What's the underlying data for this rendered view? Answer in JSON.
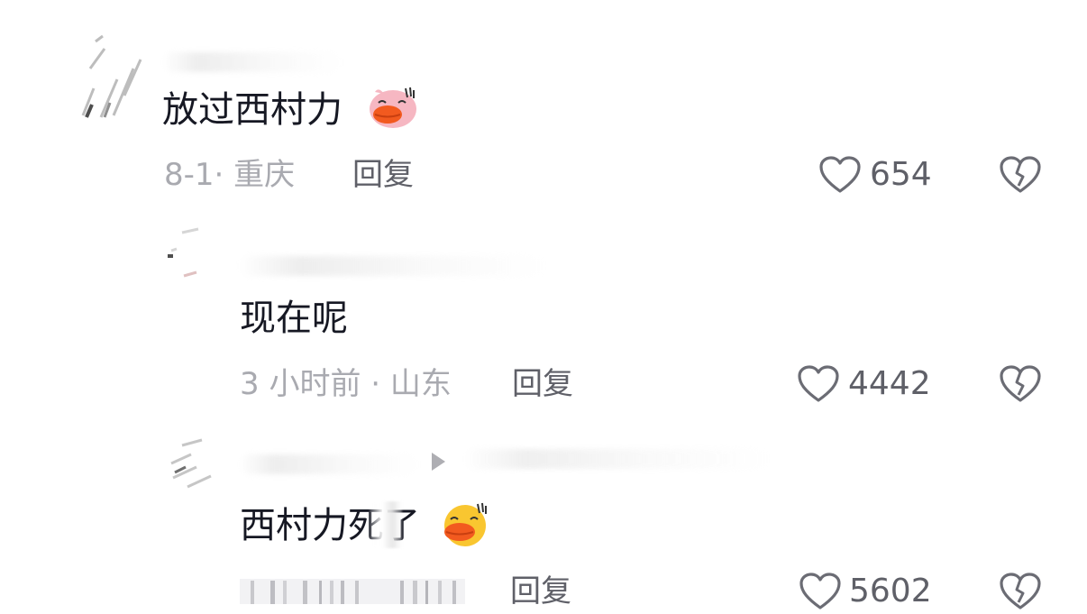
{
  "comments": [
    {
      "text": "放过西村力",
      "emoji": "pig-face-emoji",
      "meta": "8-1· 重庆",
      "reply_label": "回复",
      "likes": "654"
    },
    {
      "text": "现在呢",
      "meta": "3 小时前 · 山东",
      "reply_label": "回复",
      "likes": "4442"
    },
    {
      "text": "西村力死了",
      "text_prefix": "西村力死",
      "text_suffix": "了",
      "emoji": "smug-face-emoji",
      "reply_label": "回复",
      "likes": "5602"
    }
  ],
  "colors": {
    "text": "#161823",
    "meta": "#a9aab0",
    "action": "#5f6068",
    "emoji_pig": "#f6b7c2",
    "emoji_yellow": "#f9c630",
    "lips": "#f25a1f"
  }
}
